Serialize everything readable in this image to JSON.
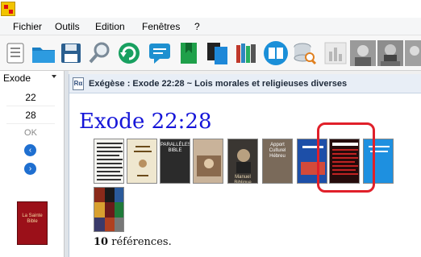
{
  "menu": {
    "items": [
      "Fichier",
      "Outils",
      "Edition",
      "Fenêtres",
      "?"
    ]
  },
  "toolbar": {
    "icons": [
      "notes-icon",
      "folder-icon",
      "save-icon",
      "search-icon",
      "sync-icon",
      "chat-icon",
      "bookmark-icon",
      "copy-icon",
      "library-icon",
      "open-book-icon",
      "database-search-icon",
      "chart-icon",
      "portrait-icon",
      "portrait-icon",
      "portrait-icon"
    ]
  },
  "navigator": {
    "book": "Exode",
    "chapter": "22",
    "verse": "28",
    "ok_label": "OK",
    "prev_symbol": "‹",
    "next_symbol": "›",
    "bible_cover": "La Sainte Bible"
  },
  "document": {
    "window_title": "Exégèse : Exode 22:28 ~ Lois morales et religieuses diverses",
    "window_icon_label": "Rα",
    "heading": "Exode 22:28",
    "references_count": "10",
    "references_label": " références."
  },
  "thumbnails": [
    {
      "label": "",
      "bg": "#f4f4f0",
      "fg": "#333"
    },
    {
      "label": "",
      "bg": "#efe7cf",
      "fg": "#6b4b1a"
    },
    {
      "label": "PARALLÈLES BIBLE",
      "bg": "#2b2b2b",
      "fg": "#fff"
    },
    {
      "label": "",
      "bg": "#c9b39a",
      "fg": "#5a3b22"
    },
    {
      "label": "Manuel Biblique",
      "bg": "#3a3632",
      "fg": "#e9d8b4"
    },
    {
      "label": "Apport Culturel Hébreu",
      "bg": "#7a6a5a",
      "fg": "#fff"
    },
    {
      "label": "",
      "bg": "#1d4fa8",
      "fg": "#fff"
    },
    {
      "label": "",
      "bg": "#250b0b",
      "fg": "#d33"
    },
    {
      "label": "",
      "bg": "#1e90e0",
      "fg": "#fff"
    },
    {
      "label": "",
      "bg": "#8a2a1a",
      "fg": "#fff"
    }
  ]
}
